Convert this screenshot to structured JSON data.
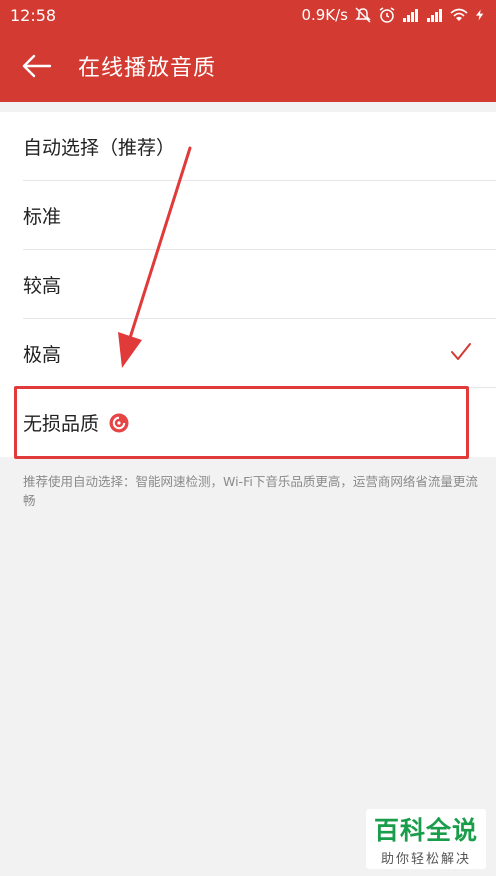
{
  "status_bar": {
    "time": "12:58",
    "network_speed": "0.9K/s",
    "icons": [
      "mute-icon",
      "alarm-icon",
      "signal-icon",
      "signal-icon",
      "wifi-icon",
      "charging-icon"
    ]
  },
  "app_bar": {
    "back_icon": "back-arrow-icon",
    "title": "在线播放音质"
  },
  "options": [
    {
      "label": "自动选择（推荐）",
      "selected": false
    },
    {
      "label": "标准",
      "selected": false
    },
    {
      "label": "较高",
      "selected": false
    },
    {
      "label": "极高",
      "selected": true
    },
    {
      "label": "无损品质",
      "selected": false,
      "badge": "lossless-icon"
    }
  ],
  "hint": "推荐使用自动选择：智能网速检测，Wi-Fi下音乐品质更高，运营商网络省流量更流畅",
  "watermark": {
    "main": "百科全说",
    "sub": "助你轻松解决"
  },
  "colors": {
    "brand_red": "#d33a31",
    "highlight_red": "#e03a3a",
    "background": "#f2f2f2",
    "watermark_green": "#1a9d4a"
  }
}
